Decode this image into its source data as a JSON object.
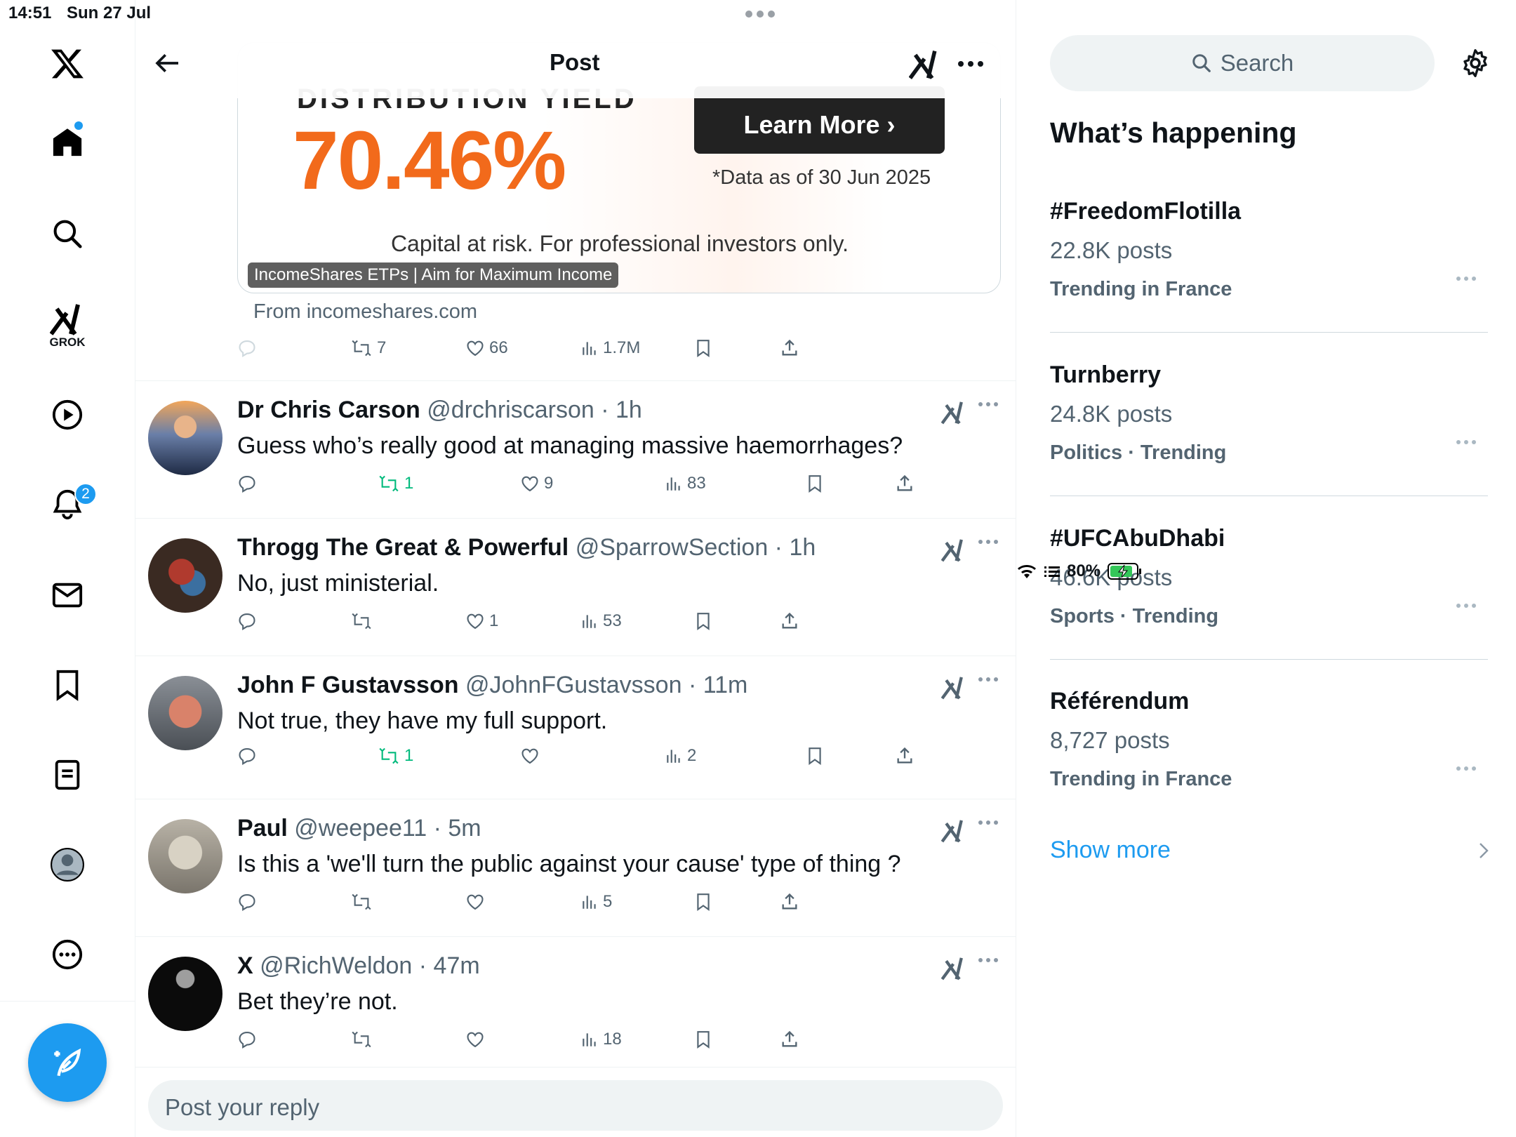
{
  "status": {
    "time": "14:51",
    "date": "Sun 27 Jul",
    "battery": "80%"
  },
  "nav": {
    "grok_label": "GROK",
    "notif_count": "2"
  },
  "header": {
    "title": "Post"
  },
  "ad": {
    "cut_text": "DISTRIBUTION YIELD",
    "yield": "70.46%",
    "button": "Learn More ›",
    "note": "*Data as of 30 Jun 2025",
    "risk": "Capital at risk. For professional investors only.",
    "caption": "IncomeShares ETPs | Aim for Maximum Income",
    "from": "From incomeshares.com",
    "reposts": "7",
    "likes": "66",
    "views": "1.7M"
  },
  "replies": [
    {
      "name": "Dr Chris Carson",
      "handle": "@drchriscarson · 1h",
      "text": "Guess who’s really good at managing massive haemorrhages?",
      "reposts": "1",
      "likes": "9",
      "views": "83"
    },
    {
      "name": "Throgg The Great & Powerful",
      "handle": "@SparrowSection · 1h",
      "text": "No, just ministerial.",
      "reposts": "",
      "likes": "1",
      "views": "53"
    },
    {
      "name": "John F Gustavsson",
      "handle": "@JohnFGustavsson · 11m",
      "text": "Not true, they have my full support.",
      "reposts": "1",
      "likes": "",
      "views": "2"
    },
    {
      "name": "Paul",
      "handle": "@weepee11 · 5m",
      "text": "Is this a 'we'll turn the public against your cause' type of thing ?",
      "reposts": "",
      "likes": "",
      "views": "5"
    },
    {
      "name": "X",
      "handle": "@RichWeldon · 47m",
      "text": "Bet they’re not.",
      "reposts": "",
      "likes": "",
      "views": "18"
    }
  ],
  "reply_box": {
    "placeholder": "Post your reply"
  },
  "sidebar": {
    "search": "Search",
    "heading": "What’s happening",
    "trends": [
      {
        "title": "#FreedomFlotilla",
        "posts": "22.8K posts",
        "context": "Trending in France"
      },
      {
        "title": "Turnberry",
        "posts": "24.8K posts",
        "context": "Politics · Trending"
      },
      {
        "title": "#UFCAbuDhabi",
        "posts": "46.6K posts",
        "context": "Sports · Trending"
      },
      {
        "title": "Référendum",
        "posts": "8,727 posts",
        "context": "Trending in France"
      }
    ],
    "show_more": "Show more"
  },
  "colors": {
    "accent": "#1d9bf0",
    "repost_green": "#00ba7c",
    "ad_orange": "#f26a1b"
  }
}
